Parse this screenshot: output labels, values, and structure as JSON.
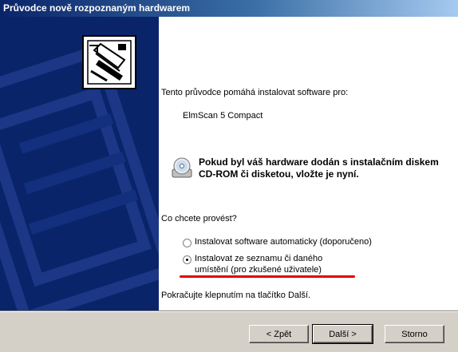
{
  "window": {
    "title": "Průvodce nově rozpoznaným hardwarem"
  },
  "content": {
    "intro": "Tento průvodce pomáhá instalovat software pro:",
    "device_name": "ElmScan 5 Compact",
    "cd_message": "Pokud byl váš hardware dodán s instalačním diskem CD-ROM či disketou, vložte je nyní.",
    "question": "Co chcete provést?",
    "options": [
      {
        "label": "Instalovat software automaticky (doporučeno)",
        "selected": false
      },
      {
        "label_line1": "Instalovat ze seznamu či daného",
        "label_line2": "umístění (pro zkušené uživatele)",
        "selected": true
      }
    ],
    "continue_hint": "Pokračujte klepnutím na tlačítko Další."
  },
  "buttons": {
    "back": "< Zpět",
    "next": "Další >",
    "cancel": "Storno"
  },
  "icons": {
    "wizard": "hardware-card-icon",
    "cd": "cd-rom-icon"
  },
  "colors": {
    "banner": "#0a246a",
    "annotation": "#e00000"
  }
}
